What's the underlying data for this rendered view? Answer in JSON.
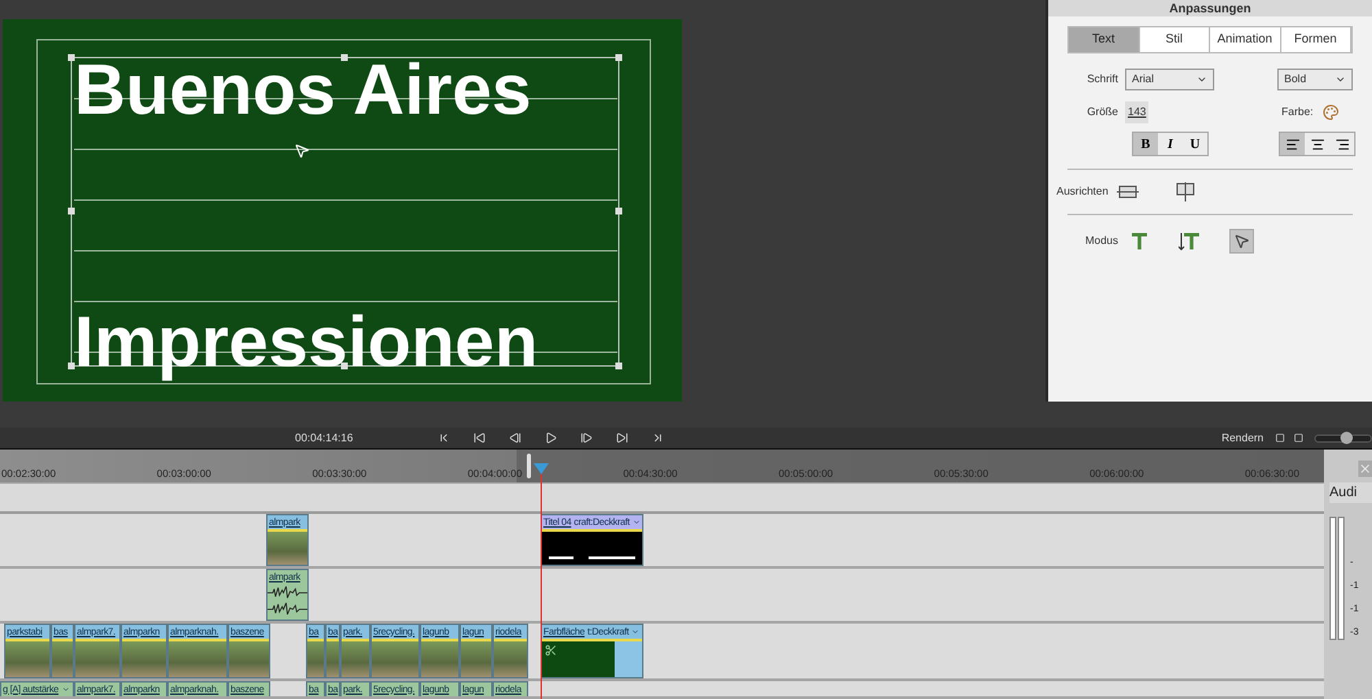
{
  "preview": {
    "lines": [
      "Buenos Aires",
      "Impressionen"
    ]
  },
  "panel": {
    "title": "Anpassungen",
    "tabs": [
      {
        "label": "Text",
        "selected": true
      },
      {
        "label": "Stil",
        "selected": false
      },
      {
        "label": "Animation",
        "selected": false
      },
      {
        "label": "Formen",
        "selected": false
      }
    ],
    "font": {
      "label": "Schrift",
      "value": "Arial"
    },
    "weight": {
      "value": "Bold"
    },
    "size": {
      "label": "Größe",
      "value": "143"
    },
    "color": {
      "label": "Farbe:"
    },
    "format_buttons": [
      {
        "label": "B",
        "kind": "bold",
        "selected": true
      },
      {
        "label": "I",
        "kind": "italic",
        "selected": false
      },
      {
        "label": "U",
        "kind": "underline",
        "selected": false
      }
    ],
    "align_buttons": [
      {
        "kind": "left",
        "selected": true
      },
      {
        "kind": "center",
        "selected": false
      },
      {
        "kind": "right",
        "selected": false
      }
    ],
    "align": {
      "label": "Ausrichten"
    },
    "mode": {
      "label": "Modus",
      "tools": [
        {
          "kind": "horizontal",
          "selected": false
        },
        {
          "kind": "vertical",
          "selected": false
        },
        {
          "kind": "select",
          "selected": true
        }
      ]
    }
  },
  "transport": {
    "timecode": "00:04:14:16",
    "render": "Rendern",
    "zoom": {
      "level": 0.55
    }
  },
  "ruler": [
    "00:02:30:00",
    "00:03:00:00",
    "00:03:30:00",
    "00:04:00:00",
    "00:04:30:00",
    "00:05:00:00",
    "00:05:30:00",
    "00:06:00:00",
    "00:06:30:00"
  ],
  "tracks": [
    {
      "clips": [
        {
          "kind": "video",
          "label": "almpark"
        },
        {
          "kind": "title",
          "label": "Titel 04",
          "effect": "craft:Deckkraft"
        }
      ]
    },
    {
      "clips": [
        {
          "kind": "audio",
          "label": "almpark"
        }
      ]
    },
    {
      "clips": [
        {
          "kind": "video",
          "label": "parkstabi"
        },
        {
          "kind": "video",
          "label": "bas"
        },
        {
          "kind": "video",
          "label": "almpark7."
        },
        {
          "kind": "video",
          "label": "almparkn"
        },
        {
          "kind": "video",
          "label": "almparknah."
        },
        {
          "kind": "video",
          "label": "baszene"
        },
        {
          "kind": "video",
          "label": "ba"
        },
        {
          "kind": "video",
          "label": "ba"
        },
        {
          "kind": "video",
          "label": "park."
        },
        {
          "kind": "video",
          "label": "5recycling."
        },
        {
          "kind": "video",
          "label": "lagunb"
        },
        {
          "kind": "video",
          "label": "lagun"
        },
        {
          "kind": "video",
          "label": "riodela"
        },
        {
          "kind": "color",
          "label": "Farbfläche",
          "effect": "t:Deckkraft"
        }
      ]
    },
    {
      "clips": [
        {
          "kind": "audio",
          "label": "g [A] autstärke",
          "dropdown": true
        },
        {
          "kind": "audio",
          "label": "almpark7."
        },
        {
          "kind": "audio",
          "label": "almparkn"
        },
        {
          "kind": "audio",
          "label": "almparknah."
        },
        {
          "kind": "audio",
          "label": "baszene"
        },
        {
          "kind": "audio",
          "label": "ba"
        },
        {
          "kind": "audio",
          "label": "ba"
        },
        {
          "kind": "audio",
          "label": "park."
        },
        {
          "kind": "audio",
          "label": "5recycling."
        },
        {
          "kind": "audio",
          "label": "lagunb"
        },
        {
          "kind": "audio",
          "label": "lagun"
        },
        {
          "kind": "audio",
          "label": "riodela"
        }
      ]
    }
  ],
  "mixer": {
    "title": "Audi",
    "labels": [
      "-",
      "-1",
      "-1",
      "-3"
    ]
  }
}
